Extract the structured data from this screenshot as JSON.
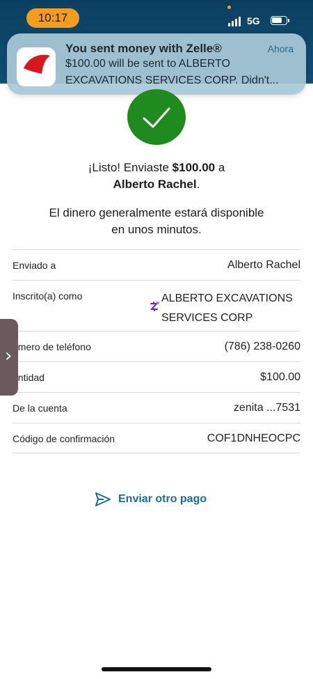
{
  "status_bar": {
    "time": "10:17",
    "network": "5G"
  },
  "notification": {
    "title": "You sent money with Zelle®",
    "time": "Ahora",
    "body_line1": "$100.00 will be sent to ALBERTO",
    "body_line2": "EXCAVATIONS SERVICES CORP. Didn't..."
  },
  "confirmation": {
    "message_prefix": "¡Listo! Enviaste ",
    "amount": "$100.00",
    "message_suffix": " a",
    "recipient": "Alberto Rachel",
    "period": ".",
    "availability_line1": "El dinero generalmente estará disponible",
    "availability_line2": "en unos minutos."
  },
  "details": {
    "sent_to_label": "Enviado a",
    "sent_to_value": "Alberto Rachel",
    "enrolled_label": "Inscrito(a) como",
    "enrolled_value_line1": "ALBERTO EXCAVATIONS",
    "enrolled_value_line2": "SERVICES CORP",
    "phone_label": "úmero de teléfono",
    "phone_value": "(786) 238-0260",
    "amount_label": "antidad",
    "amount_value": "$100.00",
    "account_label": "De la cuenta",
    "account_value": "zenita ...7531",
    "code_label": "Código de confirmación",
    "code_value": "COF1DNHEOCPC"
  },
  "actions": {
    "send_again": "Enviar otro pago"
  },
  "colors": {
    "header": "#0b3f61",
    "time_pill": "#f39c1e",
    "success": "#1f8b1f",
    "link": "#1d6b93",
    "zelle": "#6d1ed4"
  },
  "icons": {
    "check": "check-icon",
    "send": "paper-plane-icon",
    "zelle": "zelle-icon",
    "chevron": "chevron-right-icon"
  }
}
